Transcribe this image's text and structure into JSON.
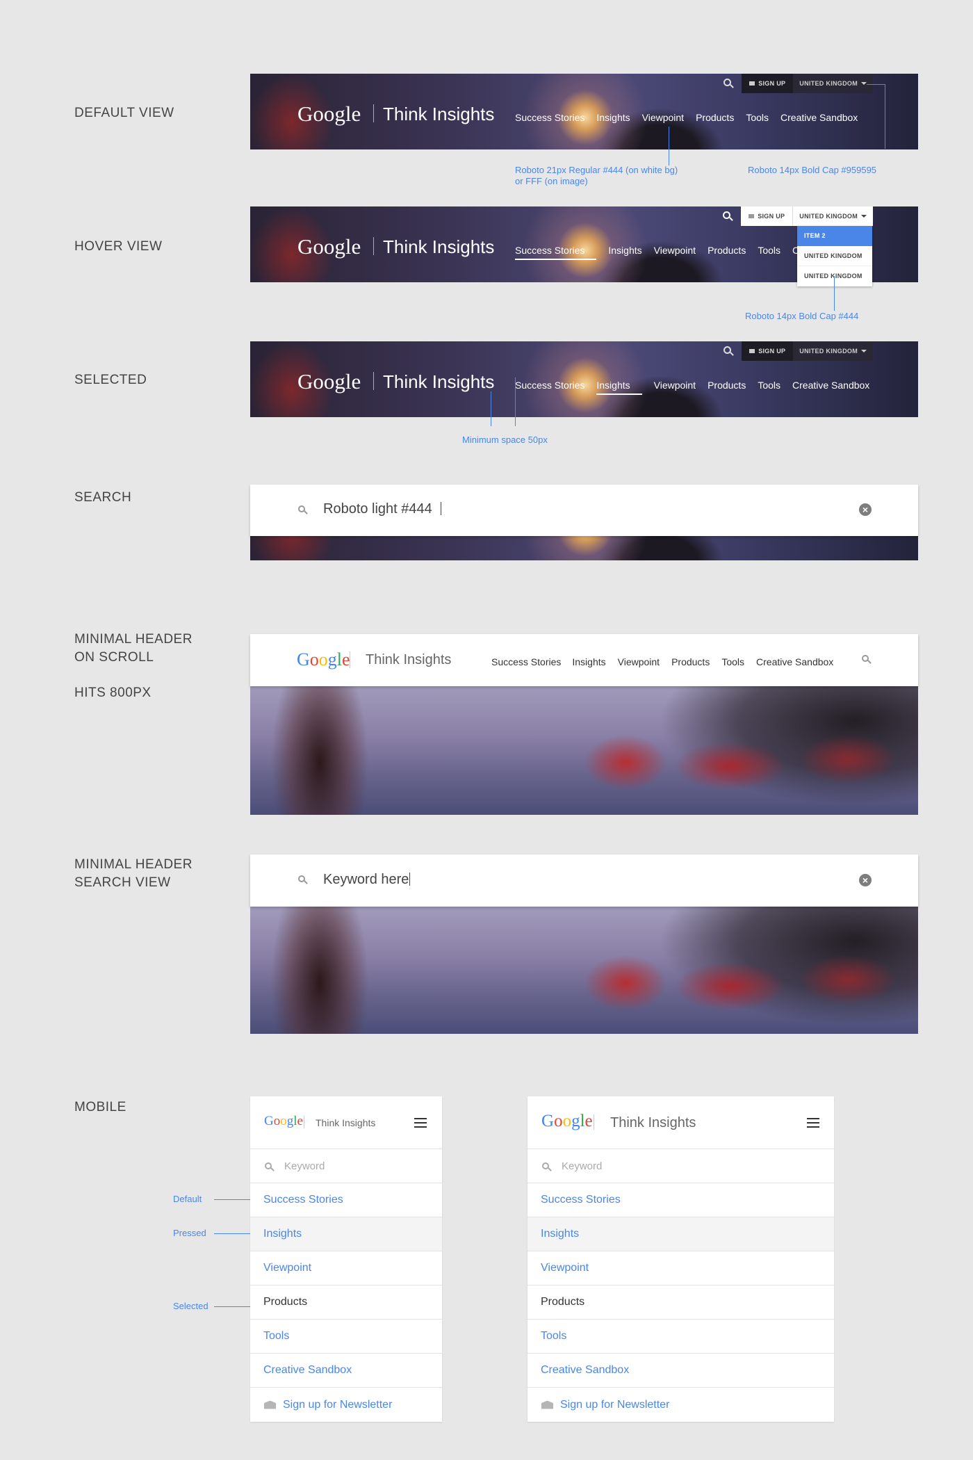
{
  "labels": {
    "default_view": "DEFAULT VIEW",
    "hover_view": "HOVER VIEW",
    "selected": "SELECTED",
    "search": "SEARCH",
    "minimal_on_scroll_1": "MINIMAL HEADER",
    "minimal_on_scroll_2": "ON SCROLL",
    "hits": "HITS 800PX",
    "minimal_search_1": "MINIMAL HEADER",
    "minimal_search_2": "SEARCH VIEW",
    "mobile": "MOBILE"
  },
  "brand": {
    "google": "Google",
    "product": "Think Insights"
  },
  "nav": [
    "Success Stories",
    "Insights",
    "Viewpoint",
    "Products",
    "Tools",
    "Creative Sandbox"
  ],
  "util": {
    "signup": "SIGN UP",
    "country": "UNITED KINGDOM"
  },
  "dropdown": [
    "ITEM 2",
    "UNITED KINGDOM",
    "UNITED KINGDOM"
  ],
  "notes": {
    "nav_font_1": "Roboto 21px Regular #444 (on white bg)",
    "nav_font_2": "or FFF (on image)",
    "util_font": "Roboto 14px Bold Cap #959595",
    "dropdown_font": "Roboto 14px Bold Cap #444",
    "min_space": "Minimum space 50px",
    "default": "Default",
    "pressed": "Pressed",
    "selected": "Selected"
  },
  "search": {
    "value_large": "Roboto light #444",
    "value_minimal": "Keyword here"
  },
  "mobile": {
    "keyword_placeholder": "Keyword",
    "items": [
      "Success Stories",
      "Insights",
      "Viewpoint",
      "Products",
      "Tools",
      "Creative Sandbox"
    ],
    "newsletter": "Sign up for Newsletter"
  },
  "colors": {
    "accent": "#4a86e8",
    "text": "#444444",
    "util_text": "#959595",
    "google_blue": "#4285f4",
    "google_red": "#ea4335",
    "google_yellow": "#fbbc05",
    "google_green": "#34a853"
  }
}
